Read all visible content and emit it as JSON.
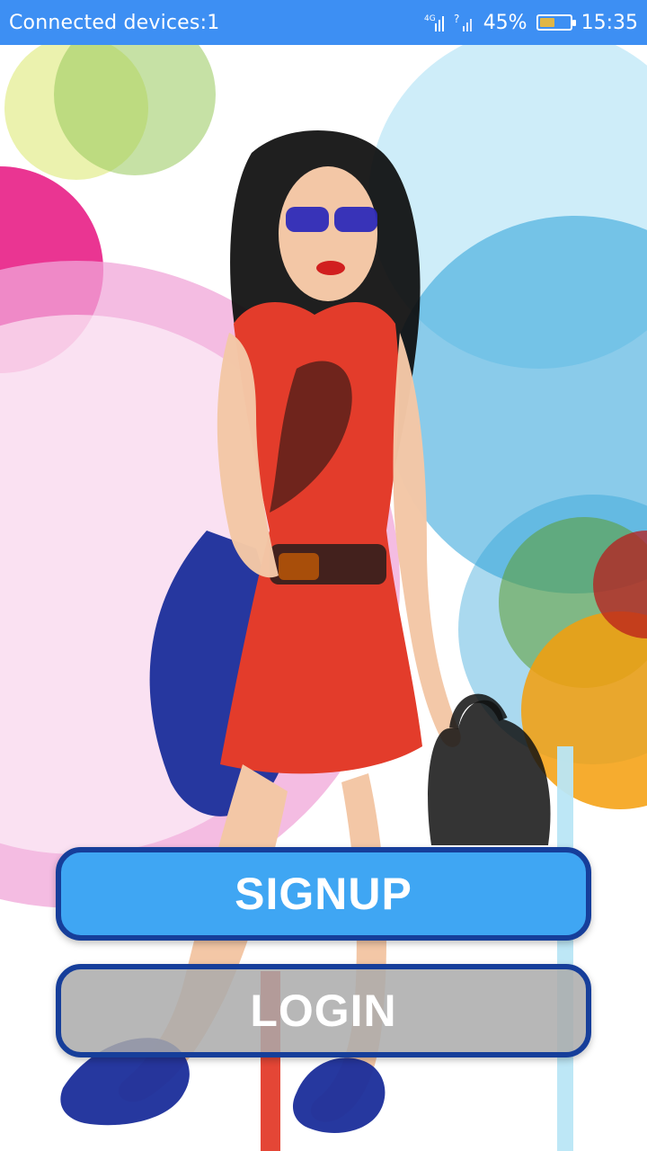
{
  "status_bar": {
    "connected_text": "Connected devices:1",
    "network_label": "4G",
    "signal_unknown": "?",
    "battery_percent_text": "45%",
    "battery_level": 0.45,
    "time": "15:35",
    "bg_color": "#3d8ff3"
  },
  "illustration": {
    "subject": "fashion-woman-illustration",
    "palette": [
      "#e7f0a0",
      "#e81f86",
      "#f0a6d8",
      "#2aa1d8",
      "#e33c2b",
      "#1a2d9a",
      "#f59e0b"
    ]
  },
  "actions": {
    "signup_label": "SIGNUP",
    "login_label": "LOGIN",
    "signup_color": "#3fa6f3",
    "border_color": "#163e9a"
  }
}
